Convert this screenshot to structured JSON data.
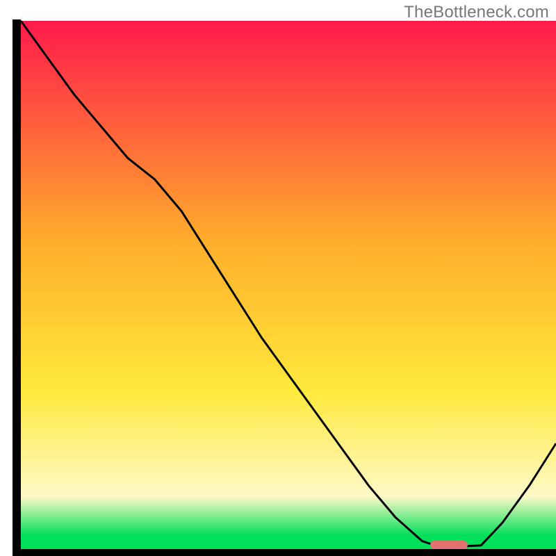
{
  "watermark": "TheBottleneck.com",
  "colors": {
    "axis": "#000000",
    "curve": "#000000",
    "marker_fill": "#e2716f",
    "grad_top": "#ff1a4b",
    "grad_mid1": "#ffae2b",
    "grad_mid2": "#ffe93c",
    "grad_pale": "#fff9c7",
    "grad_green": "#00e05a"
  },
  "chart_data": {
    "type": "line",
    "title": "",
    "xlabel": "",
    "ylabel": "",
    "xlim": [
      0,
      100
    ],
    "ylim": [
      0,
      100
    ],
    "x": [
      0,
      5,
      10,
      15,
      20,
      25,
      30,
      35,
      40,
      45,
      50,
      55,
      60,
      65,
      70,
      75,
      78,
      82,
      86,
      90,
      95,
      100
    ],
    "values": [
      100,
      93,
      86,
      80,
      74,
      70,
      64,
      56,
      48,
      40,
      33,
      26,
      19,
      12,
      6,
      1.5,
      0.5,
      0.5,
      0.7,
      5,
      12,
      20
    ],
    "marker": {
      "x_center": 80,
      "y": 0.8,
      "width": 7,
      "height": 1.6
    },
    "gradient_stops": [
      {
        "offset": 0.0,
        "key": "grad_top"
      },
      {
        "offset": 0.42,
        "key": "grad_mid1"
      },
      {
        "offset": 0.7,
        "key": "grad_mid2"
      },
      {
        "offset": 0.9,
        "key": "grad_pale"
      },
      {
        "offset": 0.975,
        "key": "grad_green"
      },
      {
        "offset": 1.0,
        "key": "grad_green"
      }
    ]
  }
}
